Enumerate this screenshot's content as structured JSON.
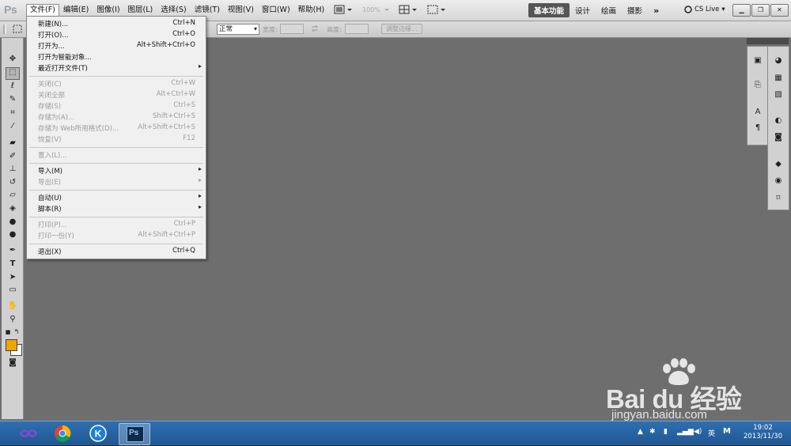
{
  "app": {
    "logo": "Ps",
    "menus": [
      "文件(F)",
      "编辑(E)",
      "图像(I)",
      "图层(L)",
      "选择(S)",
      "滤镜(T)",
      "视图(V)",
      "窗口(W)",
      "帮助(H)"
    ],
    "zoom": "100%",
    "workspaces": [
      "基本功能",
      "设计",
      "绘画",
      "摄影"
    ],
    "workspace_more": "»",
    "cs_live": "CS Live",
    "window_buttons": [
      "minimize-icon",
      "restore-icon",
      "close-icon"
    ]
  },
  "options": {
    "style_select": "正常",
    "width_label": "宽度:",
    "height_label": "高度:",
    "refine_edge": "调整边缘..."
  },
  "file_menu": {
    "groups": [
      [
        {
          "label": "新建(N)...",
          "shortcut": "Ctrl+N",
          "disabled": false
        },
        {
          "label": "打开(O)...",
          "shortcut": "Ctrl+O",
          "disabled": false
        },
        {
          "label": "打开为...",
          "shortcut": "Alt+Shift+Ctrl+O",
          "disabled": false
        },
        {
          "label": "打开为智能对象...",
          "shortcut": "",
          "disabled": false
        },
        {
          "label": "最近打开文件(T)",
          "shortcut": "",
          "disabled": false,
          "submenu": true
        }
      ],
      [
        {
          "label": "关闭(C)",
          "shortcut": "Ctrl+W",
          "disabled": true
        },
        {
          "label": "关闭全部",
          "shortcut": "Alt+Ctrl+W",
          "disabled": true
        },
        {
          "label": "存储(S)",
          "shortcut": "Ctrl+S",
          "disabled": true
        },
        {
          "label": "存储为(A)...",
          "shortcut": "Shift+Ctrl+S",
          "disabled": true
        },
        {
          "label": "存储为 Web所用格式(D)...",
          "shortcut": "Alt+Shift+Ctrl+S",
          "disabled": true
        },
        {
          "label": "恢复(V)",
          "shortcut": "F12",
          "disabled": true
        }
      ],
      [
        {
          "label": "置入(L)...",
          "shortcut": "",
          "disabled": true
        }
      ],
      [
        {
          "label": "导入(M)",
          "shortcut": "",
          "disabled": false,
          "submenu": true
        },
        {
          "label": "导出(E)",
          "shortcut": "",
          "disabled": true,
          "submenu": true
        }
      ],
      [
        {
          "label": "自动(U)",
          "shortcut": "",
          "disabled": false,
          "submenu": true
        },
        {
          "label": "脚本(R)",
          "shortcut": "",
          "disabled": false,
          "submenu": true
        }
      ],
      [
        {
          "label": "打印(P)...",
          "shortcut": "Ctrl+P",
          "disabled": true
        },
        {
          "label": "打印一份(Y)",
          "shortcut": "Alt+Shift+Ctrl+P",
          "disabled": true
        }
      ],
      [
        {
          "label": "退出(X)",
          "shortcut": "Ctrl+Q",
          "disabled": false
        }
      ]
    ]
  },
  "colors": {
    "foreground": "#f0a400",
    "background": "#ffffff",
    "canvas": "#6e6e6e"
  },
  "watermark": {
    "brand": "Bai du 经验",
    "url": "jingyan.baidu.com"
  },
  "taskbar": {
    "apps": [
      "infinity-app-icon",
      "chrome-icon",
      "kugou-icon",
      "photoshop-icon"
    ],
    "photoshop_label": "Ps",
    "ime": "英",
    "ime_mode": "M",
    "time": "19:02",
    "date": "2013/11/30"
  }
}
